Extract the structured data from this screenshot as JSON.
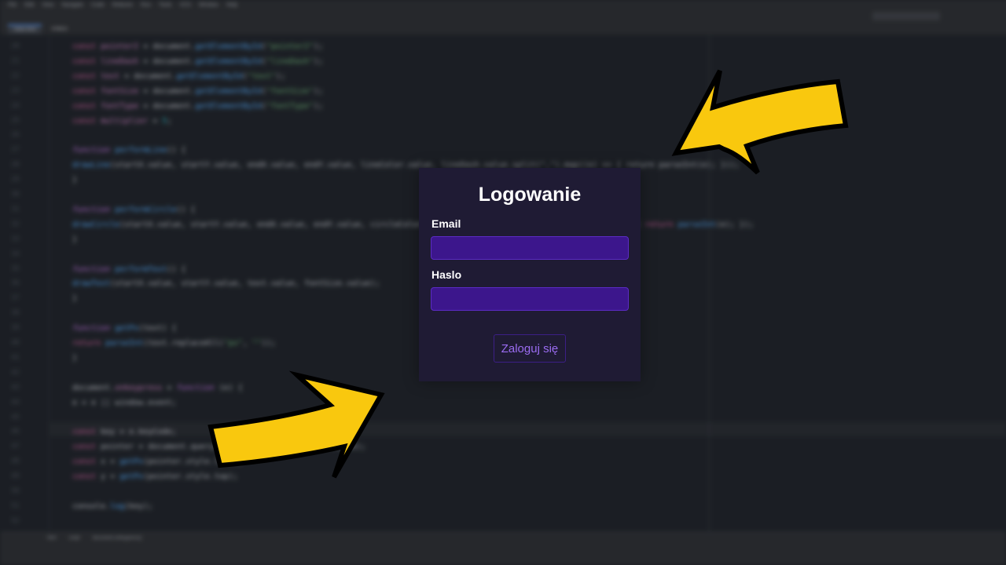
{
  "ide": {
    "menu": [
      "File",
      "Edit",
      "View",
      "Navigate",
      "Code",
      "Refactor",
      "Run",
      "Tools",
      "VCS",
      "Window",
      "Help"
    ],
    "tabs": [
      "index.html",
      "script.js"
    ],
    "code_lines": [
      {
        "n": "20",
        "t": [
          [
            "kw",
            "const "
          ],
          [
            "var",
            "pointer2"
          ],
          [
            "",
            " = document."
          ],
          [
            "fn",
            "getElementById"
          ],
          [
            "",
            "("
          ],
          [
            "str",
            "\"pointer2\""
          ],
          [
            "",
            ");"
          ]
        ]
      },
      {
        "n": "21",
        "t": [
          [
            "kw",
            "const "
          ],
          [
            "var",
            "lineDash"
          ],
          [
            "",
            " = document."
          ],
          [
            "fn",
            "getElementById"
          ],
          [
            "",
            "("
          ],
          [
            "str",
            "\"lineDash\""
          ],
          [
            "",
            ");"
          ]
        ]
      },
      {
        "n": "22",
        "t": [
          [
            "kw",
            "const "
          ],
          [
            "var",
            "text"
          ],
          [
            "",
            " = document."
          ],
          [
            "fn",
            "getElementById"
          ],
          [
            "",
            "("
          ],
          [
            "str",
            "\"text\""
          ],
          [
            "",
            ");"
          ]
        ]
      },
      {
        "n": "23",
        "t": [
          [
            "kw",
            "const "
          ],
          [
            "var",
            "fontSize"
          ],
          [
            "",
            " = document."
          ],
          [
            "fn",
            "getElementById"
          ],
          [
            "",
            "("
          ],
          [
            "str",
            "\"fontSize\""
          ],
          [
            "",
            ");"
          ]
        ]
      },
      {
        "n": "24",
        "t": [
          [
            "kw",
            "const "
          ],
          [
            "var",
            "fontType"
          ],
          [
            "",
            " = document."
          ],
          [
            "fn",
            "getElementById"
          ],
          [
            "",
            "("
          ],
          [
            "str",
            "\"fontType\""
          ],
          [
            "",
            ");"
          ]
        ]
      },
      {
        "n": "25",
        "t": [
          [
            "kw",
            "const "
          ],
          [
            "var",
            "multiplier"
          ],
          [
            "",
            " = "
          ],
          [
            "num",
            "5"
          ],
          [
            "",
            ";"
          ]
        ]
      },
      {
        "n": "26",
        "t": []
      },
      {
        "n": "27",
        "t": [
          [
            "fnkw",
            "function "
          ],
          [
            "fn",
            "performLine"
          ],
          [
            "",
            "() {"
          ]
        ]
      },
      {
        "n": "28",
        "t": [
          [
            "",
            "    "
          ],
          [
            "fn",
            "drawLine"
          ],
          [
            "",
            "(startX.value, startY.value, endX.value, endY.value, lineColor.value, lineDash.value.split(\",\").map((e) => { return parseInt(e); }));"
          ]
        ]
      },
      {
        "n": "29",
        "t": [
          [
            "",
            "}"
          ]
        ]
      },
      {
        "n": "30",
        "t": []
      },
      {
        "n": "31",
        "t": [
          [
            "fnkw",
            "function "
          ],
          [
            "fn",
            "performCircle"
          ],
          [
            "",
            "() {"
          ]
        ]
      },
      {
        "n": "32",
        "t": [
          [
            "",
            "    "
          ],
          [
            "fn",
            "drawCircle"
          ],
          [
            "",
            "(startX.value, startY.value, endX.value, endY.value, circleColor.value, lineDash.value.split(\":\").map((e) => { "
          ],
          [
            "kw",
            "return "
          ],
          [
            "fn",
            "parseInt"
          ],
          [
            "",
            "(e); });"
          ]
        ]
      },
      {
        "n": "33",
        "t": [
          [
            "",
            "}"
          ]
        ]
      },
      {
        "n": "34",
        "t": []
      },
      {
        "n": "35",
        "t": [
          [
            "fnkw",
            "function "
          ],
          [
            "fn",
            "performText"
          ],
          [
            "",
            "() {"
          ]
        ]
      },
      {
        "n": "36",
        "t": [
          [
            "",
            "    "
          ],
          [
            "fn",
            "drawText"
          ],
          [
            "",
            "(startX.value, startY.value, text.value, fontSize.value);"
          ]
        ]
      },
      {
        "n": "37",
        "t": [
          [
            "",
            "}"
          ]
        ]
      },
      {
        "n": "38",
        "t": []
      },
      {
        "n": "39",
        "t": [
          [
            "fnkw",
            "function "
          ],
          [
            "fn",
            "getPx"
          ],
          [
            "",
            "(text) {"
          ]
        ]
      },
      {
        "n": "40",
        "t": [
          [
            "",
            "    "
          ],
          [
            "kw",
            "return "
          ],
          [
            "fn",
            "parseInt"
          ],
          [
            "",
            "(text.replaceAll("
          ],
          [
            "str",
            "\"px\""
          ],
          [
            "",
            ", "
          ],
          [
            "str",
            "\"\""
          ],
          [
            "",
            "));"
          ]
        ]
      },
      {
        "n": "41",
        "t": [
          [
            "",
            "}"
          ]
        ]
      },
      {
        "n": "42",
        "t": []
      },
      {
        "n": "43",
        "t": [
          [
            "",
            "document."
          ],
          [
            "var",
            "onkeypress"
          ],
          [
            "",
            " = "
          ],
          [
            "fnkw",
            "function "
          ],
          [
            "",
            "(e) {"
          ]
        ]
      },
      {
        "n": "44",
        "t": [
          [
            "",
            "    e = e || window.event;"
          ]
        ]
      },
      {
        "n": "45",
        "t": []
      },
      {
        "n": "46",
        "t": [
          [
            "",
            "    "
          ],
          [
            "kw",
            "const "
          ],
          [
            "",
            "key = e.keyCode;"
          ]
        ]
      },
      {
        "n": "47",
        "t": [
          [
            "",
            "    "
          ],
          [
            "kw",
            "const "
          ],
          [
            "",
            "pointer = document.querySelector(pointerSelector.value);"
          ]
        ]
      },
      {
        "n": "48",
        "t": [
          [
            "",
            "    "
          ],
          [
            "kw",
            "const "
          ],
          [
            "",
            "x = "
          ],
          [
            "fn",
            "getPx"
          ],
          [
            "",
            "(pointer.style.left);"
          ]
        ]
      },
      {
        "n": "49",
        "t": [
          [
            "",
            "    "
          ],
          [
            "kw",
            "const "
          ],
          [
            "",
            "y = "
          ],
          [
            "fn",
            "getPx"
          ],
          [
            "",
            "(pointer.style.top);"
          ]
        ]
      },
      {
        "n": "50",
        "t": []
      },
      {
        "n": "51",
        "t": [
          [
            "",
            "    console."
          ],
          [
            "fn",
            "log"
          ],
          [
            "",
            "(key);"
          ]
        ]
      },
      {
        "n": "52",
        "t": []
      }
    ],
    "status_items": [
      "html",
      "script",
      "document.onkeypress()"
    ]
  },
  "login": {
    "title": "Logowanie",
    "email_label": "Email",
    "email_value": "",
    "password_label": "Haslo",
    "password_value": "",
    "submit_label": "Zaloguj się"
  },
  "colors": {
    "panel_bg": "#1f1b34",
    "input_bg": "#3c168c",
    "button_text": "#9b6cf2",
    "arrow_fill": "#f9c80e",
    "arrow_stroke": "#000000"
  }
}
